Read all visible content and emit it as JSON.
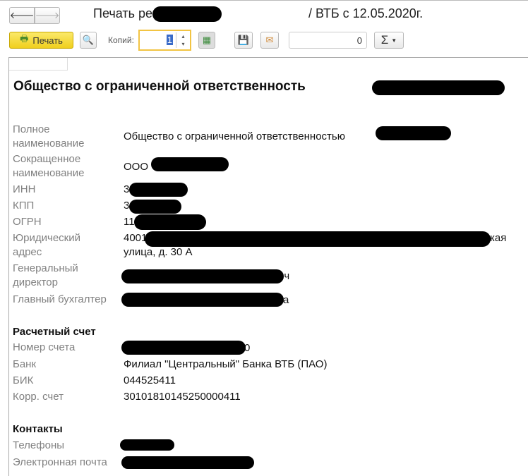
{
  "window": {
    "title_prefix": "Печать реквизит: ОС",
    "title_suffix": "/ ВТБ с 12.05.2020г."
  },
  "toolbar": {
    "print_label": "Печать",
    "copies_label": "Копий:",
    "copies_value": "1",
    "sum_value": "0",
    "sigma": "Σ"
  },
  "doc": {
    "heading": "Общество с ограниченной ответственность",
    "rows": [
      {
        "label": "Полное наименование",
        "value": "Общество с ограниченной ответственностью"
      },
      {
        "label": "Сокращенное наименование",
        "value": "ООО"
      },
      {
        "label": "ИНН",
        "value": "3"
      },
      {
        "label": "КПП",
        "value": "3"
      },
      {
        "label": "ОГРН",
        "value": "11"
      },
      {
        "label": "Юридический адрес",
        "value": "4001",
        "value_end": "кая",
        "value2": "улица, д. 30 А"
      },
      {
        "label": "Генеральный директор",
        "value_end": "вич"
      },
      {
        "label": "Главный бухгалтер",
        "value_end": "а"
      }
    ],
    "account_section": "Расчетный счет",
    "account_rows": [
      {
        "label": "Номер счета",
        "value_end": "0"
      },
      {
        "label": "Банк",
        "value": "Филиал \"Центральный\" Банка ВТБ (ПАО)"
      },
      {
        "label": "БИК",
        "value": "044525411"
      },
      {
        "label": "Корр. счет",
        "value": "30101810145250000411"
      }
    ],
    "contacts_section": "Контакты",
    "contact_rows": [
      {
        "label": "Телефоны"
      },
      {
        "label": "Электронная почта"
      }
    ]
  }
}
